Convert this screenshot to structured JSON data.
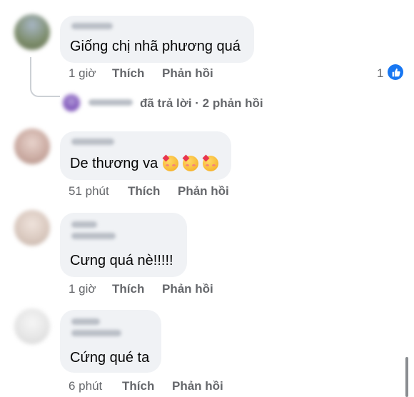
{
  "comments": [
    {
      "text": "Giống chị nhã phương quá",
      "time": "1 giờ",
      "like_label": "Thích",
      "reply_label": "Phản hồi",
      "reaction_count": "1",
      "reaction_icon": "thumbs-up-icon",
      "avatar_color": "#7c8c6a",
      "replies": {
        "text": "đã trả lời · 2 phản hồi"
      }
    },
    {
      "text": "De thương va",
      "emojis": [
        "smiling-face-with-hearts-icon",
        "smiling-face-with-hearts-icon",
        "smiling-face-with-hearts-icon"
      ],
      "time": "51 phút",
      "like_label": "Thích",
      "reply_label": "Phản hồi",
      "avatar_color": "#c9a9a0"
    },
    {
      "text": "Cưng quá nè!!!!!",
      "time": "1 giờ",
      "like_label": "Thích",
      "reply_label": "Phản hồi",
      "avatar_color": "#d8c7bd"
    },
    {
      "text": "Cứng qué ta",
      "time": "6 phút",
      "like_label": "Thích",
      "reply_label": "Phản hồi",
      "avatar_color": "#e4e4e4"
    }
  ],
  "colors": {
    "bubble": "#f0f2f5",
    "meta_text": "#65676b",
    "like_blue": "#1877f2"
  }
}
